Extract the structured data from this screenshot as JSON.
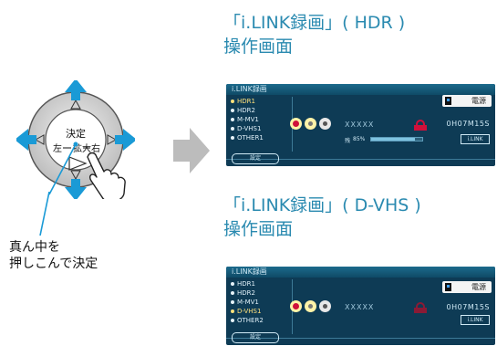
{
  "remote": {
    "center_label": "決定",
    "left_label": "左",
    "right_label": "右",
    "zoom_label": "拡大",
    "caption_line1": "真ん中を",
    "caption_line2": "押しこんで決定"
  },
  "screens": [
    {
      "heading_line1": "「i.LINK録画」( HDR )",
      "heading_line2": "操作画面",
      "panel_title": "i.LINK録画",
      "inputs": [
        "HDR1",
        "HDR2",
        "M-MV1",
        "D-VHS1",
        "OTHER1"
      ],
      "selected_index": 0,
      "title_placeholder": "XXXXX",
      "power_label": "電源",
      "remaining": "0H07M15S",
      "ilink_label": "i.LINK",
      "remain_prefix": "残",
      "remain_pct_label": "85%",
      "remain_fraction": 0.85,
      "settings_label": "設定"
    },
    {
      "heading_line1": "「i.LINK録画」( D-VHS )",
      "heading_line2": "操作画面",
      "panel_title": "i.LINK録画",
      "inputs": [
        "HDR1",
        "HDR2",
        "M-MV1",
        "D-VHS1",
        "OTHER2"
      ],
      "selected_index": 3,
      "title_placeholder": "XXXXX",
      "power_label": "電源",
      "remaining": "0H07M15S",
      "ilink_label": "i.LINK",
      "settings_label": "設定"
    }
  ],
  "colors": {
    "accent_blue": "#1a9ad6",
    "heading": "#2a8ab0",
    "panel_bg": "#0e3b55",
    "record_red": "#d0103a"
  }
}
